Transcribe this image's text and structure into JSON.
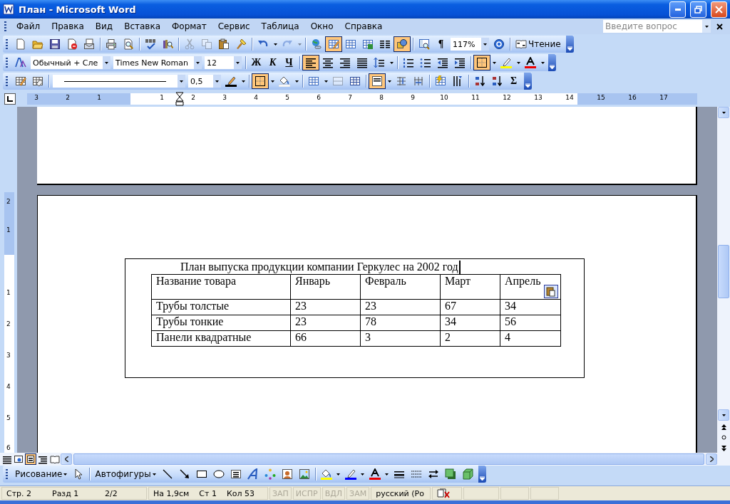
{
  "window": {
    "title": "План - Microsoft Word"
  },
  "menu": [
    {
      "label": "Файл"
    },
    {
      "label": "Правка"
    },
    {
      "label": "Вид"
    },
    {
      "label": "Вставка"
    },
    {
      "label": "Формат"
    },
    {
      "label": "Сервис"
    },
    {
      "label": "Таблица"
    },
    {
      "label": "Окно"
    },
    {
      "label": "Справка"
    }
  ],
  "help_box": {
    "placeholder": "Введите вопрос"
  },
  "toolbars": [
    {
      "items": [
        {
          "kind": "button",
          "pressed": false,
          "disabled": false
        },
        {
          "kind": "button",
          "pressed": false,
          "disabled": false
        },
        {
          "kind": "button",
          "pressed": false,
          "disabled": false
        },
        {
          "kind": "button",
          "pressed": false,
          "disabled": false
        },
        {
          "kind": "button",
          "pressed": false,
          "disabled": false
        },
        {
          "kind": "separator"
        },
        {
          "kind": "button",
          "pressed": false,
          "disabled": false
        },
        {
          "kind": "button",
          "pressed": false,
          "disabled": false
        },
        {
          "kind": "separator"
        },
        {
          "kind": "button",
          "pressed": false,
          "disabled": false
        },
        {
          "kind": "button",
          "pressed": false,
          "disabled": false
        },
        {
          "kind": "separator"
        },
        {
          "kind": "button",
          "pressed": false,
          "disabled": true
        },
        {
          "kind": "button",
          "pressed": false,
          "disabled": true
        },
        {
          "kind": "button",
          "pressed": false,
          "disabled": false
        },
        {
          "kind": "button",
          "pressed": false,
          "disabled": false
        },
        {
          "kind": "separator"
        },
        {
          "kind": "split",
          "pressed": false,
          "disabled": false
        },
        {
          "kind": "split",
          "pressed": false,
          "disabled": true
        },
        {
          "kind": "separator"
        },
        {
          "kind": "button",
          "pressed": false,
          "disabled": false
        },
        {
          "kind": "button",
          "pressed": true,
          "disabled": false
        },
        {
          "kind": "button",
          "pressed": false,
          "disabled": false
        },
        {
          "kind": "button",
          "pressed": false,
          "disabled": false
        },
        {
          "kind": "button",
          "pressed": false,
          "disabled": false
        },
        {
          "kind": "button",
          "pressed": true,
          "disabled": false
        },
        {
          "kind": "separator"
        },
        {
          "kind": "button",
          "pressed": false,
          "disabled": false
        },
        {
          "kind": "letter",
          "label": "¶"
        },
        {
          "kind": "combo",
          "value": "117%"
        },
        {
          "kind": "button",
          "pressed": false,
          "disabled": false
        },
        {
          "kind": "separator"
        },
        {
          "kind": "text-button",
          "label": "Чтение"
        }
      ]
    },
    {
      "items": [
        {
          "kind": "button",
          "pressed": false,
          "disabled": false
        },
        {
          "kind": "combo",
          "value": "Обычный + Сле"
        },
        {
          "kind": "combo",
          "value": "Times New Roman"
        },
        {
          "kind": "combo",
          "value": "12"
        },
        {
          "kind": "separator"
        },
        {
          "kind": "letter",
          "label": "Ж"
        },
        {
          "kind": "letter",
          "label": "К"
        },
        {
          "kind": "letter",
          "label": "Ч"
        },
        {
          "kind": "separator"
        },
        {
          "kind": "button",
          "pressed": true,
          "disabled": false
        },
        {
          "kind": "button",
          "pressed": false,
          "disabled": false
        },
        {
          "kind": "button",
          "pressed": false,
          "disabled": false
        },
        {
          "kind": "button",
          "pressed": false,
          "disabled": false
        },
        {
          "kind": "split",
          "pressed": false,
          "disabled": false
        },
        {
          "kind": "separator"
        },
        {
          "kind": "button",
          "pressed": false,
          "disabled": false
        },
        {
          "kind": "button",
          "pressed": false,
          "disabled": false
        },
        {
          "kind": "button",
          "pressed": false,
          "disabled": false
        },
        {
          "kind": "button",
          "pressed": false,
          "disabled": false
        },
        {
          "kind": "separator"
        },
        {
          "kind": "split",
          "pressed": true,
          "disabled": false
        },
        {
          "kind": "split",
          "pressed": false,
          "disabled": false
        },
        {
          "kind": "split",
          "pressed": false,
          "disabled": false
        }
      ]
    },
    {
      "items": [
        {
          "kind": "button",
          "pressed": false,
          "disabled": false
        },
        {
          "kind": "button",
          "pressed": false,
          "disabled": false
        },
        {
          "kind": "separator"
        },
        {
          "kind": "line-combo"
        },
        {
          "kind": "combo",
          "value": "0,5"
        },
        {
          "kind": "split",
          "pressed": false,
          "disabled": false
        },
        {
          "kind": "separator"
        },
        {
          "kind": "split",
          "pressed": true,
          "disabled": false
        },
        {
          "kind": "split",
          "pressed": false,
          "disabled": false
        },
        {
          "kind": "separator"
        },
        {
          "kind": "split",
          "pressed": false,
          "disabled": false
        },
        {
          "kind": "button",
          "pressed": false,
          "disabled": true
        },
        {
          "kind": "button",
          "pressed": false,
          "disabled": false
        },
        {
          "kind": "separator"
        },
        {
          "kind": "split",
          "pressed": true,
          "disabled": false
        },
        {
          "kind": "button",
          "pressed": false,
          "disabled": false
        },
        {
          "kind": "button",
          "pressed": false,
          "disabled": false
        },
        {
          "kind": "separator"
        },
        {
          "kind": "button",
          "pressed": false,
          "disabled": false
        },
        {
          "kind": "button",
          "pressed": false,
          "disabled": false
        },
        {
          "kind": "separator"
        },
        {
          "kind": "button",
          "pressed": false,
          "disabled": false
        },
        {
          "kind": "button",
          "pressed": false,
          "disabled": false
        },
        {
          "kind": "letter",
          "label": "Σ"
        }
      ]
    }
  ],
  "ruler": {
    "numbers": [
      "3",
      "2",
      "1",
      "1",
      "2",
      "3",
      "4",
      "5",
      "6",
      "7",
      "8",
      "9",
      "10",
      "11",
      "12",
      "13",
      "14",
      "15",
      "16",
      "17"
    ]
  },
  "vertical_ruler": {
    "numbers": [
      "2",
      "1",
      "1",
      "2",
      "3",
      "4",
      "5",
      "6"
    ]
  },
  "document": {
    "title": "План выпуска продукции компании Геркулес на 2002 год",
    "table": {
      "columns": [
        "Название товара",
        "Январь",
        "Февраль",
        "Март",
        "Апрель"
      ],
      "rows": [
        [
          "Трубы толстые",
          "23",
          "23",
          "67",
          "34"
        ],
        [
          "Трубы тонкие",
          "23",
          "78",
          "34",
          "56"
        ],
        [
          "Панели квадратные",
          "66",
          "3",
          "2",
          "4"
        ]
      ]
    }
  },
  "view_buttons": [
    {
      "selected": false
    },
    {
      "selected": false
    },
    {
      "selected": true
    },
    {
      "selected": false
    },
    {
      "selected": false
    }
  ],
  "drawing_toolbar": {
    "items": [
      {
        "kind": "menu-button",
        "label": "Рисование"
      },
      {
        "kind": "button",
        "pressed": false,
        "disabled": false
      },
      {
        "kind": "separator"
      },
      {
        "kind": "menu-button",
        "label": "Автофигуры"
      },
      {
        "kind": "button",
        "pressed": false,
        "disabled": false
      },
      {
        "kind": "button",
        "pressed": false,
        "disabled": false
      },
      {
        "kind": "button",
        "pressed": false,
        "disabled": false
      },
      {
        "kind": "button",
        "pressed": false,
        "disabled": false
      },
      {
        "kind": "button",
        "pressed": false,
        "disabled": false
      },
      {
        "kind": "button",
        "pressed": false,
        "disabled": false
      },
      {
        "kind": "button",
        "pressed": false,
        "disabled": false
      },
      {
        "kind": "button",
        "pressed": false,
        "disabled": false
      },
      {
        "kind": "button",
        "pressed": false,
        "disabled": false
      },
      {
        "kind": "separator"
      },
      {
        "kind": "split",
        "pressed": false,
        "disabled": false
      },
      {
        "kind": "split",
        "pressed": false,
        "disabled": false
      },
      {
        "kind": "split",
        "pressed": false,
        "disabled": false
      },
      {
        "kind": "button",
        "pressed": false,
        "disabled": false
      },
      {
        "kind": "button",
        "pressed": false,
        "disabled": false
      },
      {
        "kind": "button",
        "pressed": false,
        "disabled": false
      },
      {
        "kind": "button",
        "pressed": false,
        "disabled": false
      },
      {
        "kind": "button",
        "pressed": false,
        "disabled": false
      }
    ]
  },
  "status_bar": {
    "fields": [
      {
        "text": "Стр. 2"
      },
      {
        "text": "Разд 1"
      },
      {
        "text": "2/2"
      },
      {
        "text": "На 1,9см"
      },
      {
        "text": "Ст 1"
      },
      {
        "text": "Кол 53"
      }
    ],
    "modes": [
      {
        "text": "ЗАП",
        "disabled": true
      },
      {
        "text": "ИСПР",
        "disabled": true
      },
      {
        "text": "ВДЛ",
        "disabled": true
      },
      {
        "text": "ЗАМ",
        "disabled": true
      }
    ],
    "language": "русский (Ро"
  }
}
